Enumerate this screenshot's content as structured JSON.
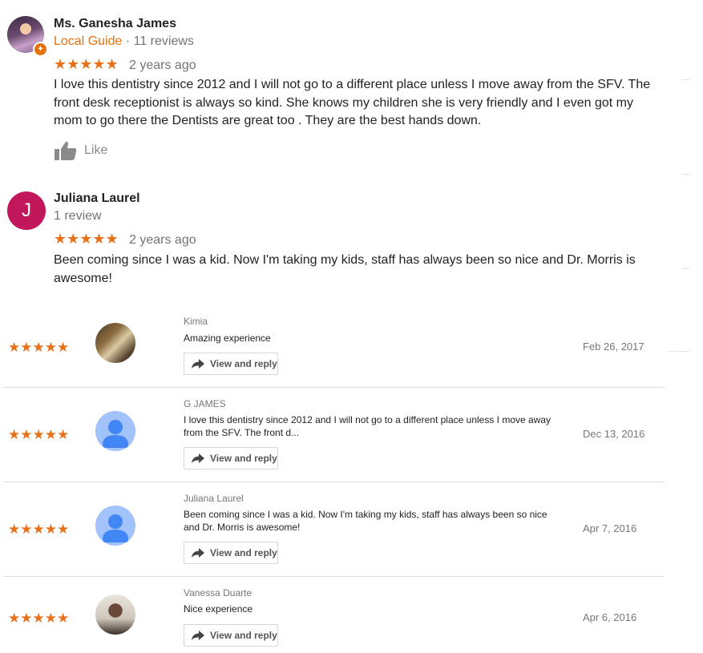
{
  "reviews": [
    {
      "name": "Ms. Ganesha James",
      "guide": "Local Guide",
      "separator": " · ",
      "count": "11 reviews",
      "stars": "★★★★★",
      "ago": "2 years ago",
      "text": "I love this dentistry since 2012  and I will not go to a different place unless I move away from the SFV. The front desk receptionist is always so kind. She knows my children she is very friendly and I even got my mom to go there the Dentists are great too .  They are the best hands down.",
      "like": "Like"
    },
    {
      "name": "Juliana Laurel",
      "initial": "J",
      "count": "1 review",
      "stars": "★★★★★",
      "ago": "2 years ago",
      "text": "Been coming since I was a kid. Now I'm taking my kids, staff has always been so nice and Dr. Morris is awesome!"
    }
  ],
  "list": [
    {
      "stars": "★★★★★",
      "author": "Kimia",
      "text": "Amazing experience",
      "reply": "View and reply",
      "date": "Feb 26, 2017"
    },
    {
      "stars": "★★★★★",
      "author": "G JAMES",
      "text": "I love this dentistry since 2012 and I will not go to a different place unless I move away from the SFV. The front d...",
      "reply": "View and reply",
      "date": "Dec 13, 2016"
    },
    {
      "stars": "★★★★★",
      "author": "Juliana Laurel",
      "text": "Been coming since I was a kid. Now I'm taking my kids, staff has always been so nice and Dr. Morris is awesome!",
      "reply": "View and reply",
      "date": "Apr 7, 2016"
    },
    {
      "stars": "★★★★★",
      "author": "Vanessa Duarte",
      "text": "Nice experience",
      "reply": "View and reply",
      "date": "Apr 6, 2016"
    }
  ],
  "colors": {
    "star": "#e7711b",
    "guide": "#e8710a",
    "letter_avatar": "#c2185b",
    "default_avatar": "#a1c2fa"
  },
  "icons": {
    "guide_badge": "local-guide-badge-icon",
    "like": "thumbs-up-icon",
    "reply": "share-arrow-icon",
    "default_avatar": "person-icon"
  }
}
